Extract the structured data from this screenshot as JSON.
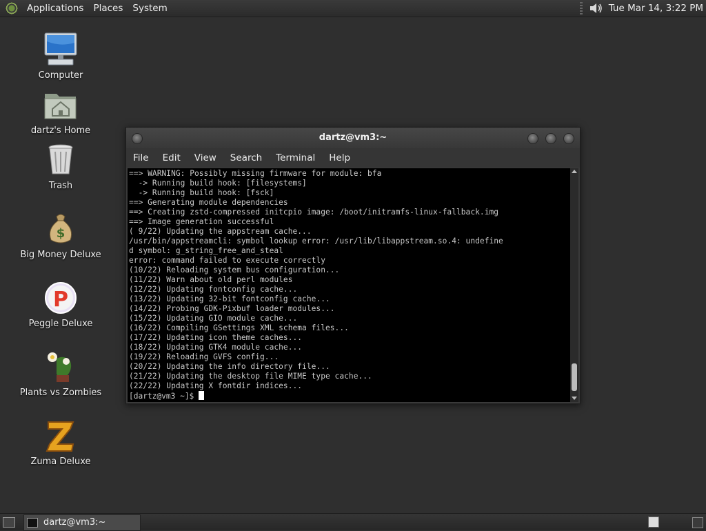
{
  "top_panel": {
    "menus": [
      "Applications",
      "Places",
      "System"
    ],
    "clock": "Tue Mar 14,  3:22 PM",
    "icons": {
      "logo": "gnome-foot-icon",
      "volume": "speaker-icon"
    }
  },
  "desktop": {
    "icons": [
      {
        "label": "Computer",
        "icon": "computer-icon"
      },
      {
        "label": "dartz's Home",
        "icon": "home-folder-icon"
      },
      {
        "label": "Trash",
        "icon": "trash-icon"
      },
      {
        "label": "Big Money Deluxe",
        "icon": "money-bag-icon"
      },
      {
        "label": "Peggle Deluxe",
        "icon": "peggle-icon"
      },
      {
        "label": "Plants vs Zombies",
        "icon": "plants-vs-zombies-icon"
      },
      {
        "label": "Zuma Deluxe",
        "icon": "zuma-icon"
      }
    ]
  },
  "terminal": {
    "title": "dartz@vm3:~",
    "menu": [
      "File",
      "Edit",
      "View",
      "Search",
      "Terminal",
      "Help"
    ],
    "lines": [
      "==> WARNING: Possibly missing firmware for module: bfa",
      "  -> Running build hook: [filesystems]",
      "  -> Running build hook: [fsck]",
      "==> Generating module dependencies",
      "==> Creating zstd-compressed initcpio image: /boot/initramfs-linux-fallback.img",
      "==> Image generation successful",
      "( 9/22) Updating the appstream cache...",
      "/usr/bin/appstreamcli: symbol lookup error: /usr/lib/libappstream.so.4: undefine",
      "d symbol: g_string_free_and_steal",
      "error: command failed to execute correctly",
      "(10/22) Reloading system bus configuration...",
      "(11/22) Warn about old perl modules",
      "(12/22) Updating fontconfig cache...",
      "(13/22) Updating 32-bit fontconfig cache...",
      "(14/22) Probing GDK-Pixbuf loader modules...",
      "(15/22) Updating GIO module cache...",
      "(16/22) Compiling GSettings XML schema files...",
      "(17/22) Updating icon theme caches...",
      "(18/22) Updating GTK4 module cache...",
      "(19/22) Reloading GVFS config...",
      "(20/22) Updating the info directory file...",
      "(21/22) Updating the desktop file MIME type cache...",
      "(22/22) Updating X fontdir indices..."
    ],
    "prompt": "[dartz@vm3 ~]$ "
  },
  "bottom_panel": {
    "task_label": "dartz@vm3:~"
  }
}
